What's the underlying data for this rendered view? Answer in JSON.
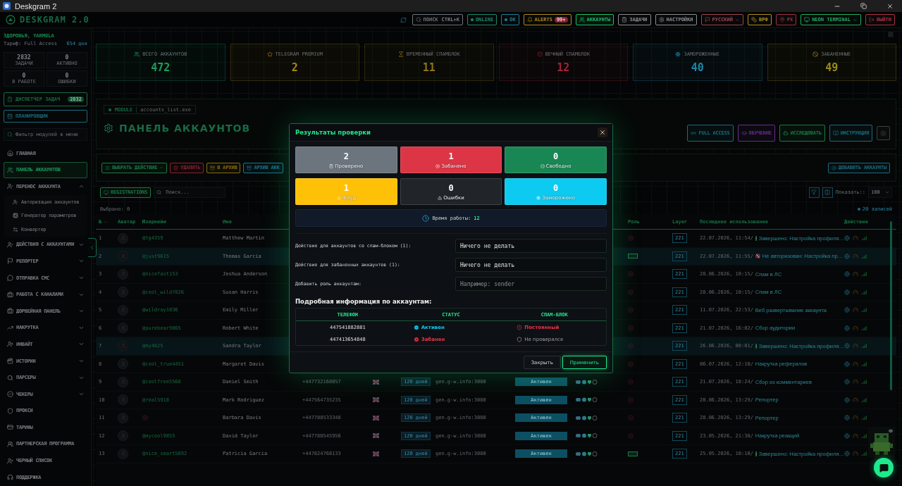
{
  "window": {
    "title": "Deskgram 2"
  },
  "header": {
    "logo": "DESKGRAM 2.0",
    "nav": [
      {
        "kind": "search",
        "label": "ПОИСК",
        "hint": "CTRL+K",
        "color": "#6d7378",
        "selected": false
      },
      {
        "kind": "status",
        "label": "ONLINE",
        "color": "#1a8a6a",
        "selected": false
      },
      {
        "kind": "status",
        "label": "OK",
        "color": "#1f7f9a",
        "selected": false
      },
      {
        "kind": "alerts",
        "label": "ALERTS",
        "badge": "99+",
        "color": "#b08a1a",
        "selected": false
      },
      {
        "kind": "link",
        "label": "АККАУНТЫ",
        "color": "#1fbf6a",
        "selected": true
      },
      {
        "kind": "link",
        "label": "ЗАДАЧИ",
        "color": "#8a8d90",
        "selected": false
      },
      {
        "kind": "link",
        "label": "НАСТРОЙКИ",
        "color": "#8a8d90",
        "selected": false
      },
      {
        "kind": "dropdown",
        "label": "РУССКИЙ",
        "color": "#a04550",
        "selected": false
      },
      {
        "kind": "coin",
        "label": "ВРФ",
        "color": "#b0901a",
        "selected": false
      },
      {
        "kind": "pin",
        "label": "РХ",
        "color": "#a03040",
        "selected": false
      },
      {
        "kind": "dropdown",
        "label": "NEON TERMINAL",
        "color": "#1fae5e",
        "selected": false
      },
      {
        "kind": "logout",
        "label": "ВЫЙТИ",
        "color": "#b03040",
        "selected": false
      }
    ]
  },
  "sidebar": {
    "greeting": "ЗДОРОВЬЯ, YARMOLA",
    "plan": "Тариф: Full Access",
    "days": "654 дня",
    "stats": [
      {
        "value": "2832",
        "label": "ЗАДАЧИ"
      },
      {
        "value": "0",
        "label": "АКТИВНО"
      },
      {
        "value": "0",
        "label": "В РАБОТЕ"
      },
      {
        "value": "0",
        "label": "ОШИБКИ"
      }
    ],
    "task_manager": {
      "label": "ДИСПЕТЧЕР ЗАДАЧ",
      "badge": "2832"
    },
    "planner": "ПЛАНИРОВЩИК",
    "filter_placeholder": "Фильтр модулей в меню",
    "menu": [
      {
        "label": "ГЛАВНАЯ",
        "selected": false
      },
      {
        "label": "ПАНЕЛЬ АККАУНТОВ",
        "selected": true
      },
      {
        "label": "ПЕРЕНОС АККАУНТА",
        "selected": false,
        "expanded": true,
        "children": [
          {
            "label": "Авторизация аккаунтов",
            "selected": false
          },
          {
            "label": "Генератор параметров",
            "selected": false
          },
          {
            "label": "Конвертер",
            "selected": false
          }
        ]
      },
      {
        "label": "ДЕЙСТВИЯ С АККАУНТАМИ",
        "selected": false,
        "expanded": false
      },
      {
        "label": "РЕПОРТЕР",
        "selected": false,
        "expanded": false
      },
      {
        "label": "ОТПРАВКА СМС",
        "selected": false,
        "expanded": false
      },
      {
        "label": "РАБОТА С КАНАЛАМИ",
        "selected": false,
        "expanded": false
      },
      {
        "label": "ДОРВЕЙНАЯ ПАНЕЛЬ",
        "selected": false,
        "expanded": false
      },
      {
        "label": "НАКРУТКА",
        "selected": false,
        "expanded": false
      },
      {
        "label": "ИНВАЙТ",
        "selected": false,
        "expanded": false
      },
      {
        "label": "ИСТОРИИ",
        "selected": false,
        "expanded": false
      },
      {
        "label": "ПАРСЕРЫ",
        "selected": false,
        "expanded": false
      },
      {
        "label": "ЧЕКЕРЫ",
        "selected": false,
        "expanded": false
      },
      {
        "label": "ПРОКСИ",
        "selected": false
      },
      {
        "label": "ТАРИФЫ",
        "selected": false
      },
      {
        "label": "ПАРТНЕРСКАЯ ПРОГРАММА",
        "selected": false
      },
      {
        "label": "ЧЕРНЫЙ СПИСОК",
        "selected": false
      },
      {
        "label": "ПОДДЕРЖКА",
        "selected": false
      }
    ]
  },
  "stats": [
    {
      "label": "ВСЕГО АККАУНТОВ",
      "value": "472",
      "color": "#1c9c5c"
    },
    {
      "label": "TELEGRAM PREMIUM",
      "value": "2",
      "color": "#a8860f"
    },
    {
      "label": "ВРЕМЕННЫЙ СПАМБЛОК",
      "value": "11",
      "color": "#8f7418"
    },
    {
      "label": "ВЕЧНЫЙ СПАМБЛОК",
      "value": "12",
      "color": "#a3233a"
    },
    {
      "label": "ЗАМОРОЖЕННЫЕ",
      "value": "40",
      "color": "#1e86a8"
    },
    {
      "label": "ЗАБАНЕННЫЕ",
      "value": "49",
      "color": "#9a8a18"
    }
  ],
  "module": {
    "tag": "MODULE",
    "file": "accounts_list.exe",
    "title": "ПАНЕЛЬ АККАУНТОВ",
    "buttons": [
      {
        "label": "FULL ACCESS",
        "color": "#1a6a80"
      },
      {
        "label": "ОБУЧЕНИЕ",
        "color": "#6a2a8a"
      },
      {
        "label": "ИССЛЕДОВАТЬ",
        "color": "#1a7a3e"
      },
      {
        "label": "ИНСТРУКЦИЯ",
        "color": "#1a6a80"
      }
    ]
  },
  "actions": {
    "buttons": [
      {
        "label": "ВЫБРАТЬ ДЕЙСТВИЕ",
        "color": "#1a7a45"
      },
      {
        "label": "УДАЛИТЬ",
        "color": "#8a1f30"
      },
      {
        "label": "В АРХИВ",
        "color": "#8a6a10"
      },
      {
        "label": "АРХИВ АКК",
        "color": "#1a7490"
      }
    ],
    "add": "ДОБАВИТЬ АККАУНТЫ"
  },
  "toolbar": {
    "registrations": "REGISTRATIONS",
    "search_placeholder": "Поиск...",
    "show_label": "Показать::",
    "page_size": "100"
  },
  "table": {
    "selected_count": "Выбрано: 0",
    "total": "20 записей",
    "columns": [
      {
        "kind": "num",
        "label": "№",
        "sorted": true
      },
      {
        "kind": "avatar",
        "label": "Аватар",
        "sorted": false
      },
      {
        "kind": "username",
        "label": "Юзернейм",
        "sorted": false
      },
      {
        "kind": "name",
        "label": "Имя",
        "sorted": false
      },
      {
        "kind": "role",
        "label": "Роль",
        "sorted": false
      },
      {
        "kind": "layer",
        "label": "Layer",
        "sorted": false
      },
      {
        "kind": "last_used",
        "label": "Последнее использование",
        "sorted": false
      },
      {
        "kind": "actions",
        "label": "Действия",
        "sorted": false
      }
    ],
    "rows": [
      {
        "num": "1",
        "username": "@tg4359",
        "name": "Matthew Martin",
        "role_set": false,
        "layer": "221",
        "time": "22.07.2026, 11:54/",
        "kind": "done",
        "activity": "Завершено: Настройка профиля…",
        "selected": false
      },
      {
        "num": "2",
        "username": "@just9615",
        "name": "Thomas Garcia",
        "role_set": true,
        "layer": "221",
        "time": "22.07.2026, 11:55/",
        "kind": "unauthorized",
        "activity": "Не авторизован: Настройка пр…",
        "selected": true
      },
      {
        "num": "3",
        "username": "@nicefast153",
        "name": "Joshua Anderson",
        "role_set": false,
        "layer": "221",
        "time": "28.06.2026, 10:15/",
        "activity": "Спам в ЛС",
        "selected": false
      },
      {
        "num": "4",
        "username": "@cool_wild7826",
        "name": "Susan Harris",
        "role_set": false,
        "layer": "221",
        "time": "28.06.2026, 10:15/",
        "activity": "Спам в ЛС",
        "selected": false
      },
      {
        "num": "5",
        "username": "@wildray1836",
        "name": "Emily Miller",
        "role_set": false,
        "layer": "221",
        "time": "11.07.2026, 22:53/",
        "activity": "Веб развертывание аккаунта",
        "selected": false
      },
      {
        "num": "6",
        "username": "@purebear9865",
        "name": "Robert White",
        "role_set": false,
        "layer": "221",
        "time": "21.07.2026, 16:02/",
        "activity": "Сбор аудитории",
        "selected": false
      },
      {
        "num": "7",
        "username": "@my4825",
        "name": "Sandra Taylor",
        "role_set": false,
        "layer": "221",
        "time": "26.06.2026, 00:01/",
        "kind": "done",
        "activity": "Завершено: Настройка профиля…",
        "selected": true
      },
      {
        "num": "8",
        "username": "@cool_true4451",
        "name": "Margaret Davis",
        "role_set": false,
        "layer": "221",
        "time": "06.07.2026, 12:10/",
        "activity": "Накрутка рефералов",
        "selected": false
      },
      {
        "num": "9",
        "username": "@coolfree5568",
        "name": "Daniel Smith",
        "phone": "+447732168057",
        "days": "120 дней",
        "proxy": "gen.g-w.info:3080",
        "status": "Активен",
        "role_set": false,
        "layer": "221",
        "time": "21.07.2026, 18:24/",
        "activity": "Сбор из комментариев",
        "selected": false
      },
      {
        "num": "10",
        "username": "@real5918",
        "name": "Mark Rodriguez",
        "phone": "+447564735235",
        "days": "120 дней",
        "proxy": "gen.g-w.info:3080",
        "status": "Активен",
        "role_set": false,
        "layer": "221",
        "time": "28.06.2026, 13:29/",
        "activity": "Репортер",
        "selected": false
      },
      {
        "num": "11",
        "name": "Barbara Davis",
        "phone": "+447788533348",
        "days": "120 дней",
        "proxy": "gen.g-w.info:3080",
        "status": "Активен",
        "role_set": false,
        "layer": "221",
        "time": "28.06.2026, 13:29/",
        "activity": "Репортер",
        "selected": false
      },
      {
        "num": "12",
        "username": "@mycool9855",
        "name": "David Taylor",
        "phone": "+447788545956",
        "days": "120 дней",
        "proxy": "gen.g-w.info:3080",
        "status": "Активен",
        "role_set": false,
        "layer": "221",
        "time": "23.05.2026, 21:38/",
        "activity": "Накрутка реакций",
        "selected": false
      },
      {
        "num": "13",
        "username": "@nice_smart5892",
        "name": "Patricia Garcia",
        "phone": "+447824768133",
        "days": "120 дней",
        "proxy": "gen.g-w.info:3080",
        "status": "Активен",
        "role_set": true,
        "layer": "221",
        "time": "25.05.2026, 10:10/",
        "kind": "done",
        "activity": "Завершено: Настройка профиля…",
        "selected": false
      }
    ]
  },
  "modal": {
    "title": "Результаты проверки",
    "tiles": [
      {
        "value": "2",
        "label": "Проверено",
        "color": "#6c757d"
      },
      {
        "value": "1",
        "label": "Забанено",
        "color": "#dc3545"
      },
      {
        "value": "0",
        "label": "Свободно",
        "color": "#198754"
      },
      {
        "value": "1",
        "label": "Флуд",
        "color": "#ffc107"
      },
      {
        "value": "0",
        "label": "Ошибки",
        "color": "#212529"
      },
      {
        "value": "0",
        "label": "Заморожено",
        "color": "#0dcaf0"
      }
    ],
    "uptime": {
      "label": "Время работы:",
      "value": "12"
    },
    "form": [
      {
        "kind": "select",
        "label": "Действие для аккаунтов со спам-блоком (1):",
        "value": "Ничего не делать"
      },
      {
        "kind": "select",
        "label": "Действие для забаненных аккаунтов (1):",
        "value": "Ничего не делать"
      },
      {
        "kind": "input",
        "label": "Добавить роль аккаунтам:",
        "placeholder": "Например: sender"
      }
    ],
    "details_title": "Подробная информация по аккаунтам:",
    "columns": [
      "ТЕЛЕФОН",
      "СТАТУС",
      "СПАМ-БЛОК"
    ],
    "rows": [
      {
        "phone": "447541882881",
        "status": {
          "kind": "active",
          "label": "Активен"
        },
        "spam": {
          "kind": "permanent",
          "label": "Постоянный"
        }
      },
      {
        "phone": "447413654848",
        "status": {
          "kind": "banned",
          "label": "Забанен"
        },
        "spam": {
          "kind": "unchecked",
          "label": "Не проверялся"
        }
      }
    ],
    "buttons": {
      "close": "Закрыть",
      "apply": "Применить"
    }
  }
}
